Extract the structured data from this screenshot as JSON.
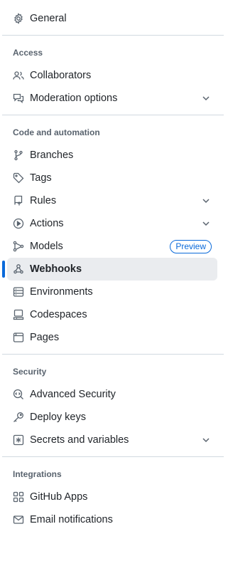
{
  "general": {
    "label": "General",
    "icon": "gear-icon"
  },
  "access": {
    "heading": "Access",
    "collaborators": {
      "label": "Collaborators",
      "icon": "people-icon"
    },
    "moderation": {
      "label": "Moderation options",
      "icon": "comment-discussion-icon"
    }
  },
  "code": {
    "heading": "Code and automation",
    "branches": {
      "label": "Branches",
      "icon": "git-branch-icon"
    },
    "tags": {
      "label": "Tags",
      "icon": "tag-icon"
    },
    "rules": {
      "label": "Rules",
      "icon": "repo-push-icon"
    },
    "actions": {
      "label": "Actions",
      "icon": "play-icon"
    },
    "models": {
      "label": "Models",
      "icon": "models-icon",
      "badge": "Preview"
    },
    "webhooks": {
      "label": "Webhooks",
      "icon": "webhook-icon"
    },
    "environments": {
      "label": "Environments",
      "icon": "server-icon"
    },
    "codespaces": {
      "label": "Codespaces",
      "icon": "codespaces-icon"
    },
    "pages": {
      "label": "Pages",
      "icon": "browser-icon"
    }
  },
  "security": {
    "heading": "Security",
    "advanced": {
      "label": "Advanced Security",
      "icon": "codescan-icon"
    },
    "deploy_keys": {
      "label": "Deploy keys",
      "icon": "key-icon"
    },
    "secrets": {
      "label": "Secrets and variables",
      "icon": "asterisk-icon"
    }
  },
  "integrations": {
    "heading": "Integrations",
    "apps": {
      "label": "GitHub Apps",
      "icon": "apps-icon"
    },
    "email": {
      "label": "Email notifications",
      "icon": "mail-icon"
    }
  },
  "colors": {
    "accent": "#0969da",
    "active_bg": "#eaecef",
    "text": "#1f2328",
    "muted": "#59636e"
  }
}
